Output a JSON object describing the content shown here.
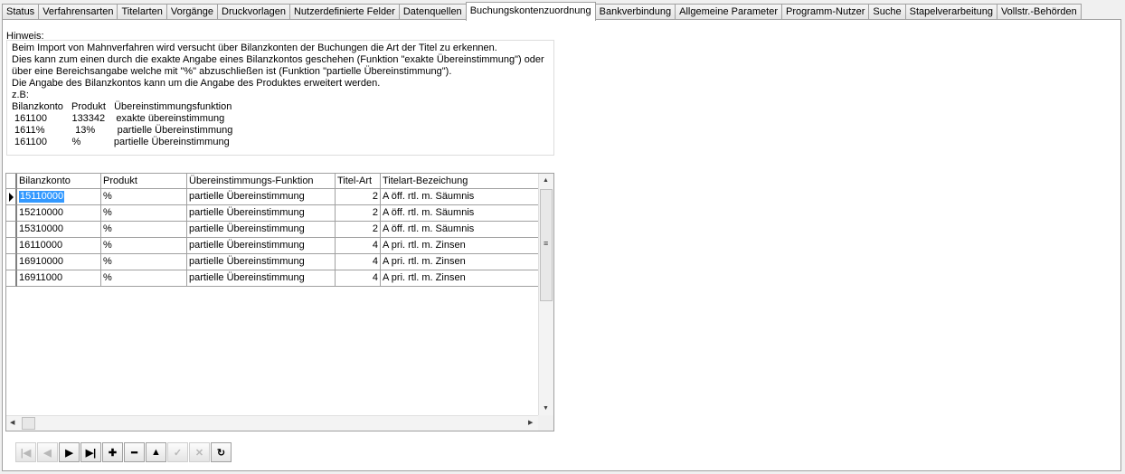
{
  "tabs": [
    "Status",
    "Verfahrensarten",
    "Titelarten",
    "Vorgänge",
    "Druckvorlagen",
    "Nutzerdefinierte Felder",
    "Datenquellen",
    "Buchungskontenzuordnung",
    "Bankverbindung",
    "Allgemeine Parameter",
    "Programm-Nutzer",
    "Suche",
    "Stapelverarbeitung",
    "Vollstr.-Behörden"
  ],
  "active_tab": "Buchungskontenzuordnung",
  "hint": {
    "label": "Hinweis:",
    "text": "Beim Import von Mahnverfahren wird versucht über Bilanzkonten der Buchungen die Art der Titel zu erkennen.\nDies kann zum einen durch die exakte Angabe eines Bilanzkontos geschehen (Funktion \"exakte Übereinstimmung\") oder\nüber eine Bereichsangabe welche mit \"%\" abzuschließen ist (Funktion \"partielle Übereinstimmung\").\nDie Angabe des Bilanzkontos kann um die Angabe des Produktes erweitert werden.\nz.B:\nBilanzkonto   Produkt   Übereinstimmungsfunktion\n 161100         133342    exakte übereinstimmung\n 1611%           13%        partielle Übereinstimmung\n 161100         %            partielle Übereinstimmung"
  },
  "grid": {
    "columns": [
      "Bilanzkonto",
      "Produkt",
      "Übereinstimmungs-Funktion",
      "Titel-Art",
      "Titelart-Bezeichung"
    ],
    "rows": [
      [
        "15110000",
        "%",
        "partielle Übereinstimmung",
        "2",
        "A öff. rtl. m. Säumnis"
      ],
      [
        "15210000",
        "%",
        "partielle Übereinstimmung",
        "2",
        "A öff. rtl. m. Säumnis"
      ],
      [
        "15310000",
        "%",
        "partielle Übereinstimmung",
        "2",
        "A öff. rtl. m. Säumnis"
      ],
      [
        "16110000",
        "%",
        "partielle Übereinstimmung",
        "4",
        "A pri. rtl. m. Zinsen"
      ],
      [
        "16910000",
        "%",
        "partielle Übereinstimmung",
        "4",
        "A pri. rtl. m. Zinsen"
      ],
      [
        "16911000",
        "%",
        "partielle Übereinstimmung",
        "4",
        "A pri. rtl. m. Zinsen"
      ]
    ],
    "current_row": 0
  },
  "navigator": [
    {
      "name": "first-record",
      "icon": "first-icon",
      "glyph": "|◀",
      "enabled": false
    },
    {
      "name": "prior-record",
      "icon": "prior-icon",
      "glyph": "◀",
      "enabled": false
    },
    {
      "name": "next-record",
      "icon": "next-icon",
      "glyph": "▶",
      "enabled": true
    },
    {
      "name": "last-record",
      "icon": "last-icon",
      "glyph": "▶|",
      "enabled": true
    },
    {
      "name": "insert-record",
      "icon": "plus-icon",
      "glyph": "✚",
      "enabled": true
    },
    {
      "name": "delete-record",
      "icon": "minus-icon",
      "glyph": "━",
      "enabled": true
    },
    {
      "name": "edit-record",
      "icon": "edit-icon",
      "glyph": "▲",
      "enabled": true
    },
    {
      "name": "post-record",
      "icon": "check-icon",
      "glyph": "✓",
      "enabled": false
    },
    {
      "name": "cancel-record",
      "icon": "cancel-icon",
      "glyph": "✕",
      "enabled": false
    },
    {
      "name": "refresh-records",
      "icon": "refresh-icon",
      "glyph": "↻",
      "enabled": true
    }
  ]
}
